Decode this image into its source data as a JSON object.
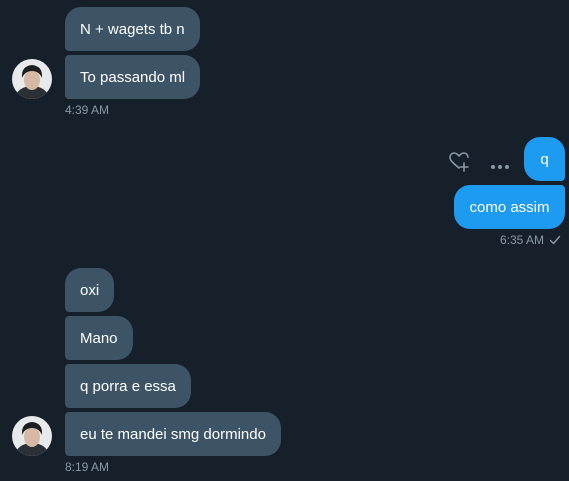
{
  "conversation": {
    "group1": {
      "messages": [
        "N + wagets tb n",
        "To passando ml"
      ],
      "timestamp": "4:39 AM"
    },
    "group2": {
      "messages": [
        "q",
        "como assim"
      ],
      "timestamp": "6:35 AM"
    },
    "group3": {
      "messages": [
        "oxi",
        "Mano",
        "q porra e essa",
        "eu te mandei smg dormindo"
      ],
      "timestamp": "8:19 AM"
    }
  },
  "icons": {
    "react": "heart-plus-icon",
    "more": "more-horizontal-icon",
    "read_receipt": "checkmark-icon"
  },
  "colors": {
    "background": "#15202b",
    "incoming_bubble": "#3d5466",
    "outgoing_bubble": "#1d9bf0",
    "timestamp": "#8b98a5"
  }
}
